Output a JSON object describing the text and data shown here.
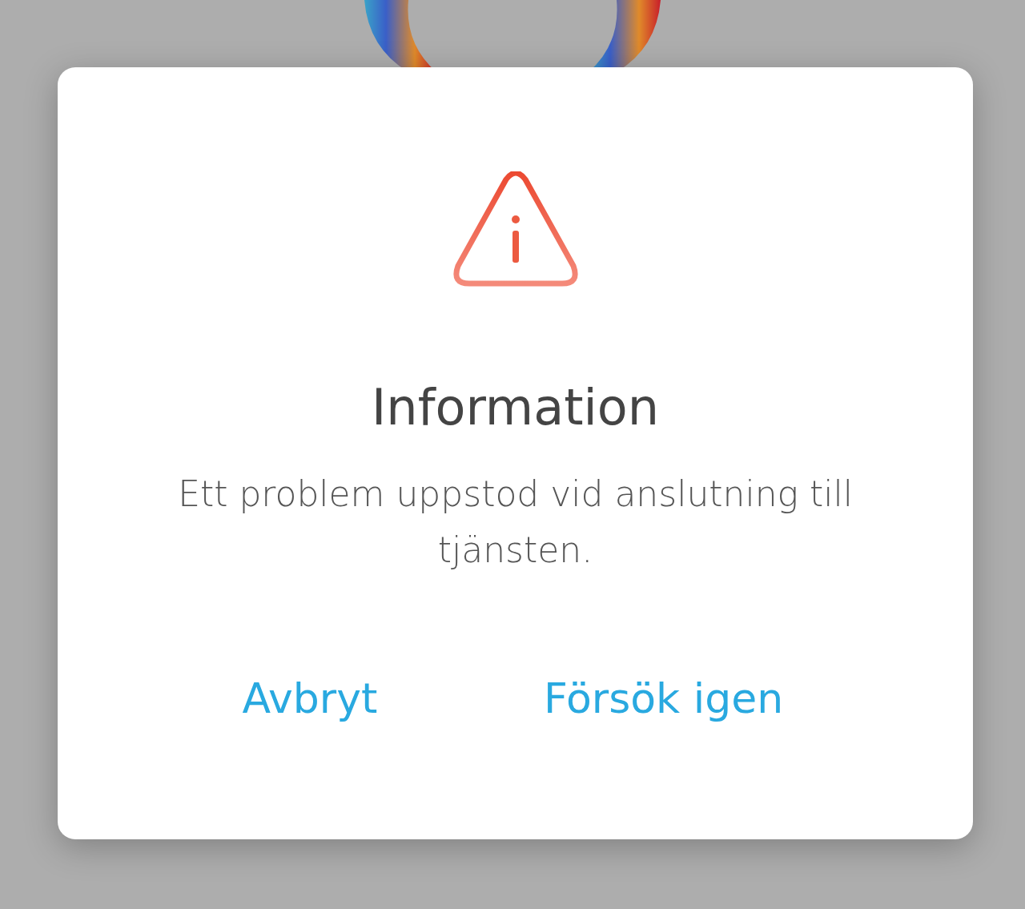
{
  "dialog": {
    "title": "Information",
    "message": "Ett problem uppstod vid anslutning till tjänsten.",
    "buttons": [
      "Avbryt",
      "Försök igen"
    ]
  }
}
